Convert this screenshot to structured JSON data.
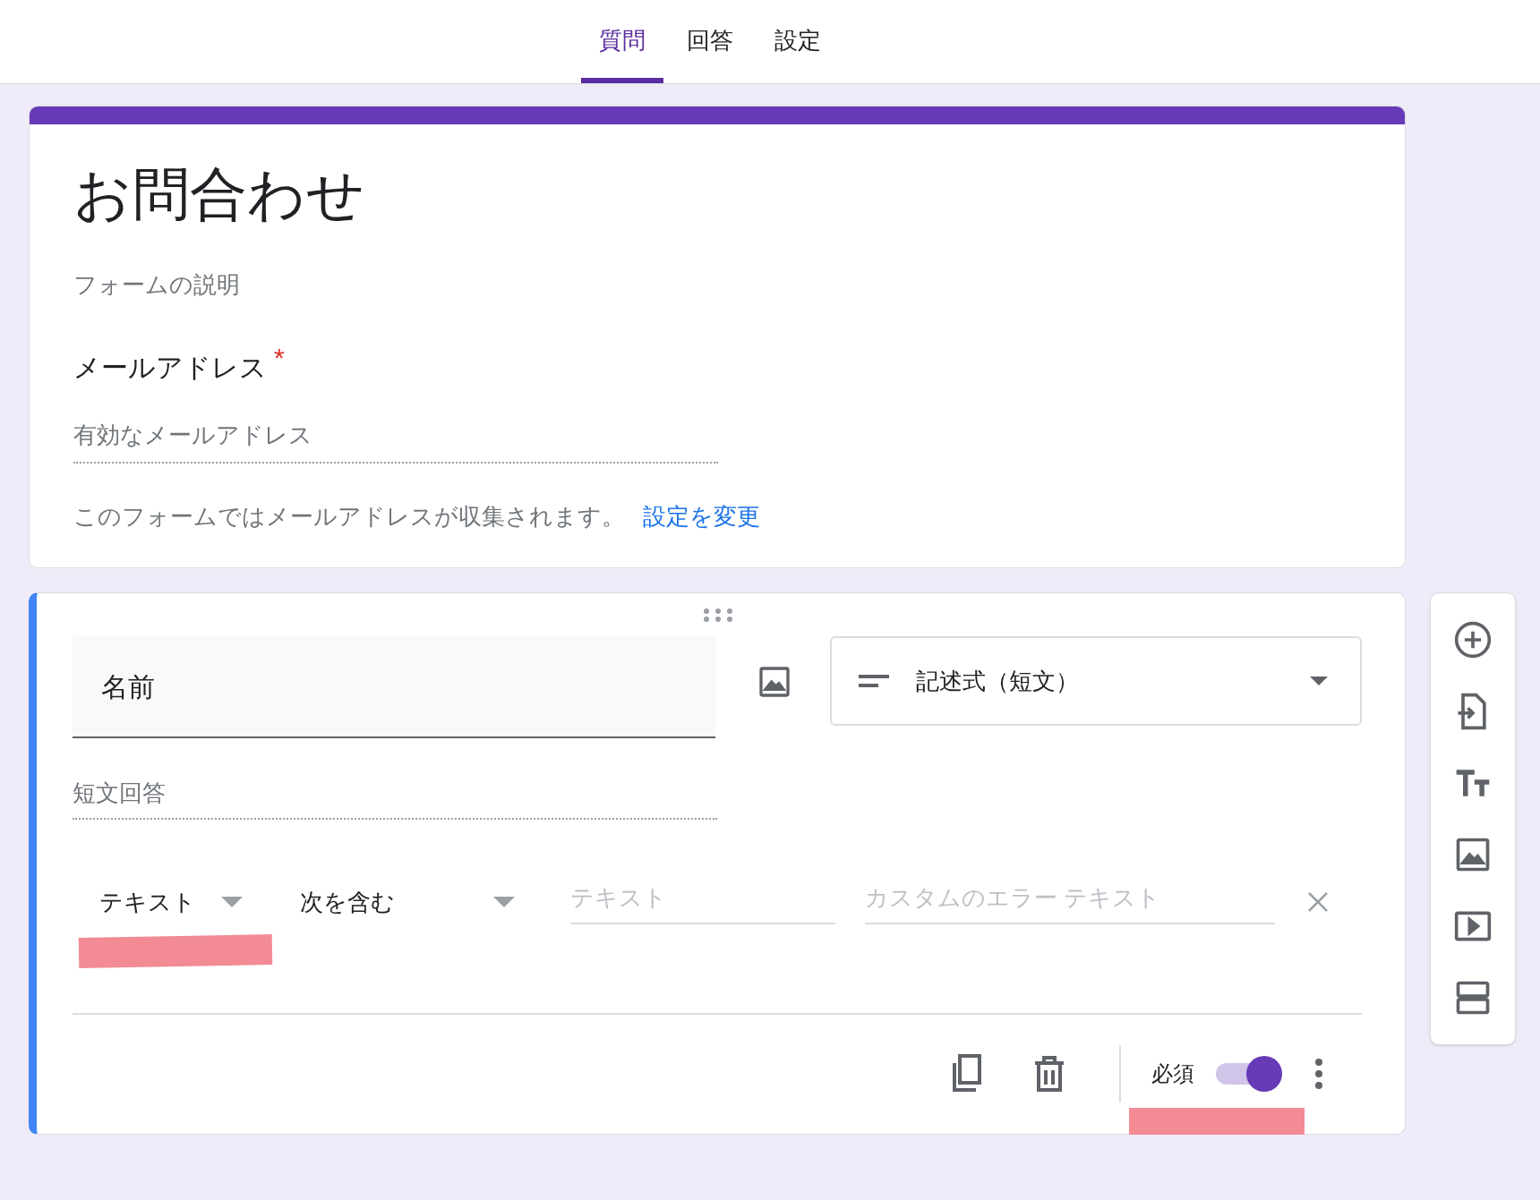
{
  "tabs": [
    {
      "label": "質問",
      "selected": true
    },
    {
      "label": "回答",
      "selected": false
    },
    {
      "label": "設定",
      "selected": false
    }
  ],
  "header_card": {
    "title": "お問合わせ",
    "description": "フォームの説明",
    "email_question": {
      "label": "メールアドレス",
      "required": true,
      "required_mark": "*",
      "placeholder": "有効なメールアドレス"
    },
    "note": "このフォームではメールアドレスが収集されます。",
    "link": "設定を変更"
  },
  "question_card": {
    "title": "名前",
    "question_type": "記述式（短文）",
    "answer_placeholder": "短文回答",
    "validation": {
      "type": "テキスト",
      "condition": "次を含む",
      "text_placeholder": "テキスト",
      "error_placeholder": "カスタムのエラー テキスト"
    },
    "required_label": "必須",
    "required": true
  }
}
